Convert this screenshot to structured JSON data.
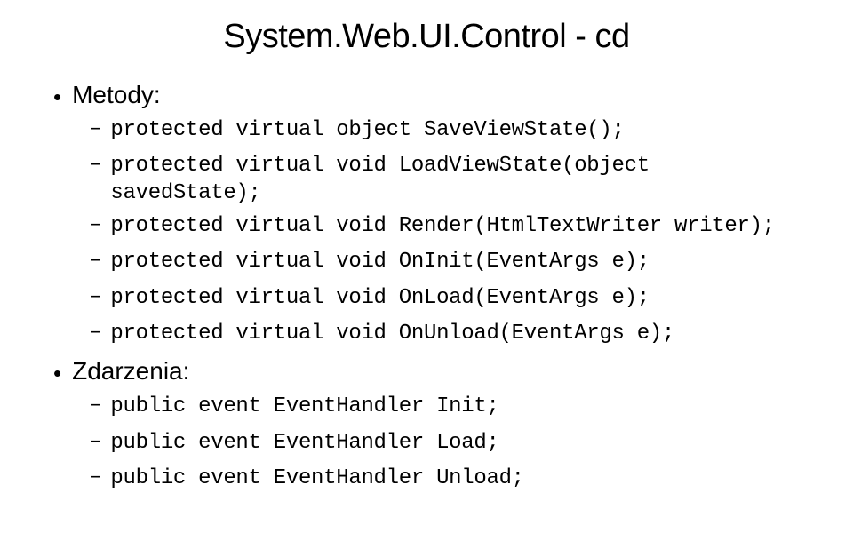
{
  "title": "System.Web.UI.Control - cd",
  "sections": [
    {
      "label": "Metody:",
      "items": [
        "protected virtual object SaveViewState();",
        "protected virtual void LoadViewState(object savedState);",
        "protected virtual void Render(HtmlTextWriter writer);",
        "protected virtual void OnInit(EventArgs e);",
        "protected virtual void OnLoad(EventArgs e);",
        "protected virtual void OnUnload(EventArgs e);"
      ]
    },
    {
      "label": "Zdarzenia:",
      "items": [
        "public event EventHandler Init;",
        "public event EventHandler Load;",
        "public event EventHandler Unload;"
      ]
    }
  ]
}
